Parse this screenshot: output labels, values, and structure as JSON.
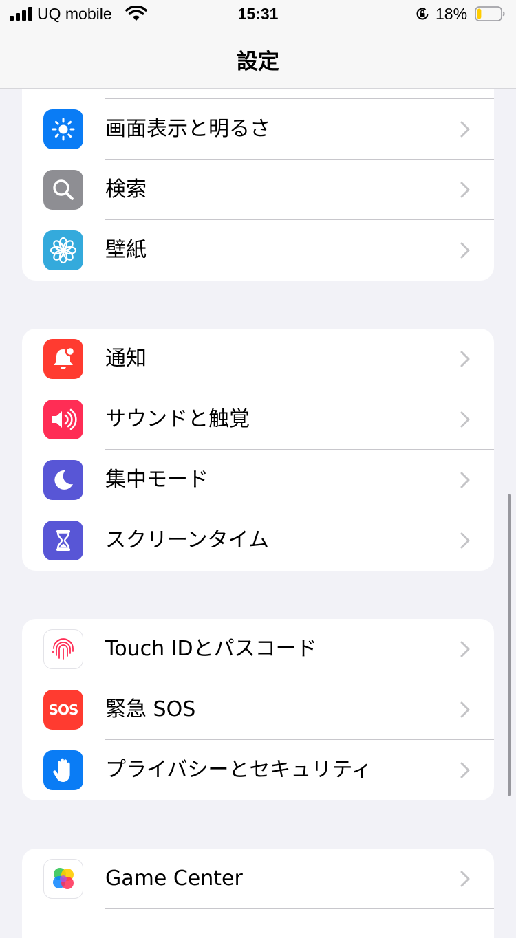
{
  "status": {
    "carrier": "UQ mobile",
    "time": "15:31",
    "battery_percent": "18%",
    "battery_level": 0.18
  },
  "nav": {
    "title": "設定"
  },
  "groups": [
    {
      "items": [
        {
          "label": "画面表示と明るさ",
          "icon": "sun-icon",
          "color": "#0a7cf5"
        },
        {
          "label": "検索",
          "icon": "magnifier-icon",
          "color": "#8e8e93"
        },
        {
          "label": "壁紙",
          "icon": "flower-icon",
          "color": "#34aadc"
        }
      ]
    },
    {
      "items": [
        {
          "label": "通知",
          "icon": "bell-icon",
          "color": "#ff3b30"
        },
        {
          "label": "サウンドと触覚",
          "icon": "speaker-icon",
          "color": "#ff2d55"
        },
        {
          "label": "集中モード",
          "icon": "moon-icon",
          "color": "#5856d6"
        },
        {
          "label": "スクリーンタイム",
          "icon": "hourglass-icon",
          "color": "#5856d6"
        }
      ]
    },
    {
      "items": [
        {
          "label": "Touch IDとパスコード",
          "icon": "fingerprint-icon",
          "color": "#ffffff"
        },
        {
          "label": "緊急 SOS",
          "icon": "sos-icon",
          "color": "#ff3b30",
          "icon_text": "SOS"
        },
        {
          "label": "プライバシーとセキュリティ",
          "icon": "hand-icon",
          "color": "#0a7cf5"
        }
      ]
    },
    {
      "items": [
        {
          "label": "Game Center",
          "icon": "game-center-icon",
          "color": "#ffffff"
        }
      ]
    }
  ]
}
